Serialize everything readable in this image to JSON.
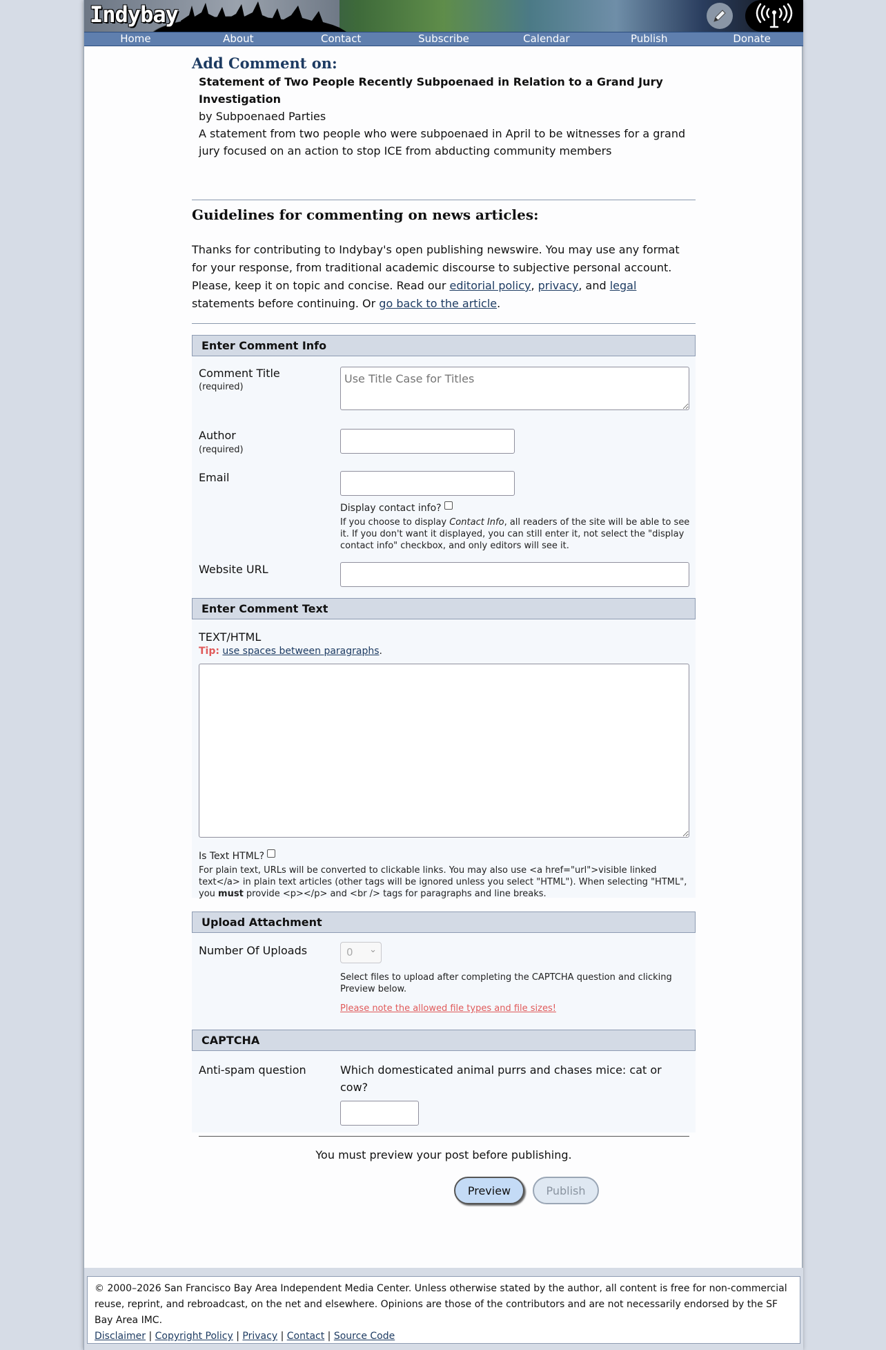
{
  "header": {
    "logo_text": "Indybay",
    "edit_icon": "pencil-icon",
    "broadcast_icon": "radio-tower-icon"
  },
  "nav": {
    "items": [
      "Home",
      "About",
      "Contact",
      "Subscribe",
      "Calendar",
      "Publish",
      "Donate"
    ]
  },
  "article": {
    "heading": "Add Comment on:",
    "title": "Statement of Two People Recently Subpoenaed in Relation to a Grand Jury Investigation",
    "byline": "by Subpoenaed Parties",
    "summary": "A statement from two people who were subpoenaed in April to be witnesses for a grand jury focused on an action to stop ICE from abducting community members"
  },
  "guidelines": {
    "heading": "Guidelines for commenting on news articles:",
    "text_1": "Thanks for contributing to Indybay's open publishing newswire. You may use any format for your response, from traditional academic discourse to subjective personal account. Please, keep it on topic and concise. Read our ",
    "link_editorial": "editorial policy",
    "sep_1": ", ",
    "link_privacy": "privacy",
    "sep_2": ", and ",
    "link_legal": "legal",
    "text_2": " statements before continuing. Or ",
    "link_back": "go back to the article",
    "text_3": "."
  },
  "comment_info": {
    "section_title": "Enter Comment Info",
    "title_label": "Comment Title",
    "required": "(required)",
    "title_placeholder": "Use Title Case for Titles",
    "author_label": "Author",
    "email_label": "Email",
    "display_contact_label": "Display contact info?",
    "contact_note_1": "If you choose to display ",
    "contact_note_em": "Contact Info",
    "contact_note_2": ", all readers of the site will be able to see it. If you don't want it displayed, you can still enter it, not select the \"display contact info\" checkbox, and only editors will see it.",
    "website_label": "Website URL"
  },
  "comment_text": {
    "section_title": "Enter Comment Text",
    "text_label": "TEXT/HTML",
    "tip_label": "Tip:",
    "tip_link": "use spaces between paragraphs",
    "tip_end": ".",
    "is_html_label": "Is Text HTML?",
    "html_note_1": "For plain text, URLs will be converted to clickable links. You may also use <a href=\"url\">visible linked text</a> in plain text articles (other tags will be ignored unless you select \"HTML\"). When selecting \"HTML\", you ",
    "html_note_strong": "must",
    "html_note_2": " provide <p></p> and <br /> tags for paragraphs and line breaks."
  },
  "upload": {
    "section_title": "Upload Attachment",
    "uploads_label": "Number Of Uploads",
    "uploads_value": "0",
    "upload_note": "Select files to upload after completing the CAPTCHA question and clicking Preview below.",
    "file_types_link": "Please note the allowed file types and file sizes!"
  },
  "captcha": {
    "section_title": "CAPTCHA",
    "label": "Anti-spam question",
    "question": "Which domesticated animal purrs and chases mice: cat or cow?"
  },
  "submit": {
    "notice": "You must preview your post before publishing.",
    "preview_label": "Preview",
    "publish_label": "Publish"
  },
  "footer": {
    "copyright": "© 2000–2026 San Francisco Bay Area Independent Media Center. Unless otherwise stated by the author, all content is free for non-commercial reuse, reprint, and rebroadcast, on the net and elsewhere. Opinions are those of the contributors and are not necessarily endorsed by the SF Bay Area IMC.",
    "links": [
      "Disclaimer",
      "Copyright Policy",
      "Privacy",
      "Contact",
      "Source Code"
    ]
  },
  "colors": {
    "nav_bg": "#5f7fae",
    "heading_blue": "#1d3b62",
    "section_head_bg": "#d3dae5",
    "tip_red": "#e05a5a",
    "warning_link": "#e05a5a"
  }
}
